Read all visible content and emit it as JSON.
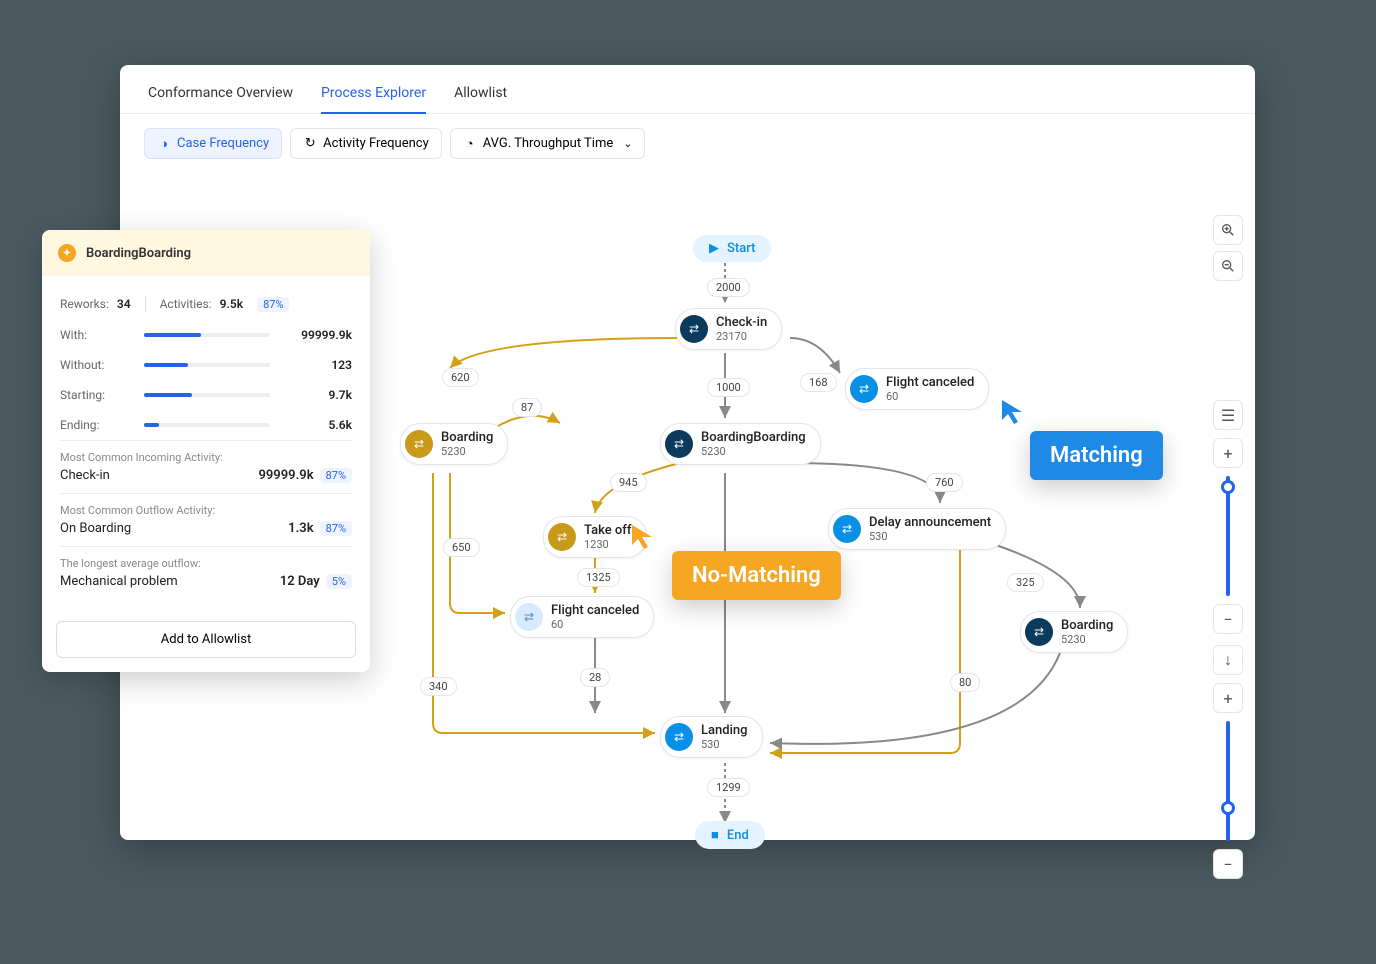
{
  "tabs": {
    "t1": "Conformance Overview",
    "t2": "Process Explorer",
    "t3": "Allowlist"
  },
  "toolbar": {
    "case_freq": "Case Frequency",
    "act_freq": "Activity Frequency",
    "throughput": "AVG. Throughput Time"
  },
  "start": "Start",
  "end": "End",
  "nodes": {
    "checkin": {
      "name": "Check-in",
      "val": "23170"
    },
    "boarding1": {
      "name": "Boarding",
      "val": "5230"
    },
    "boarding2": {
      "name": "BoardingBoarding",
      "val": "5230"
    },
    "flightc1": {
      "name": "Flight canceled",
      "val": "60"
    },
    "takeoff": {
      "name": "Take off",
      "val": "1230"
    },
    "delay": {
      "name": "Delay announcement",
      "val": "530"
    },
    "flightc2": {
      "name": "Flight canceled",
      "val": "60"
    },
    "boarding3": {
      "name": "Boarding",
      "val": "5230"
    },
    "landing": {
      "name": "Landing",
      "val": "530"
    }
  },
  "edges": {
    "e2000": "2000",
    "e620": "620",
    "e87": "87",
    "e1000": "1000",
    "e168": "168",
    "e945": "945",
    "e760": "760",
    "e650": "650",
    "e1325": "1325",
    "e325": "325",
    "e340": "340",
    "e28": "28",
    "e80": "80",
    "e1299": "1299"
  },
  "callouts": {
    "nomatch": "No-Matching",
    "match": "Matching"
  },
  "panel": {
    "title": "BoardingBoarding",
    "reworks_lbl": "Reworks:",
    "reworks_val": "34",
    "activities_lbl": "Activities:",
    "activities_val": "9.5k",
    "activities_pct": "87%",
    "with_lbl": "With:",
    "with_val": "99999.9k",
    "with_fill": "45%",
    "without_lbl": "Without:",
    "without_val": "123",
    "without_fill": "35%",
    "starting_lbl": "Starting:",
    "starting_val": "9.7k",
    "starting_fill": "38%",
    "ending_lbl": "Ending:",
    "ending_val": "5.6k",
    "ending_fill": "12%",
    "in_lbl": "Most Common Incoming Activity:",
    "in_name": "Check-in",
    "in_val": "99999.9k",
    "in_pct": "87%",
    "out_lbl": "Most Common Outflow Activity:",
    "out_name": "On Boarding",
    "out_val": "1.3k",
    "out_pct": "87%",
    "long_lbl": "The longest average outflow:",
    "long_name": "Mechanical problem",
    "long_val": "12 Day",
    "long_pct": "5%",
    "btn": "Add to Allowlist"
  }
}
